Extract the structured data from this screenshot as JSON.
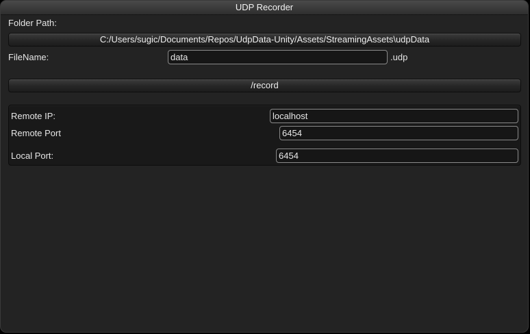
{
  "window": {
    "title": "UDP Recorder"
  },
  "recorder": {
    "folder_path_label": "Folder Path:",
    "folder_path_value": "C:/Users/sugic/Documents/Repos/UdpData-Unity/Assets/StreamingAssets\\udpData",
    "filename_label": "FileName:",
    "filename_value": "data",
    "filename_extension": ".udp",
    "record_button_label": "/record"
  },
  "network": {
    "remote_ip_label": "Remote IP:",
    "remote_ip_value": "localhost",
    "remote_port_label": "Remote Port",
    "remote_port_value": "6454",
    "local_port_label": "Local Port:",
    "local_port_value": "6454"
  }
}
